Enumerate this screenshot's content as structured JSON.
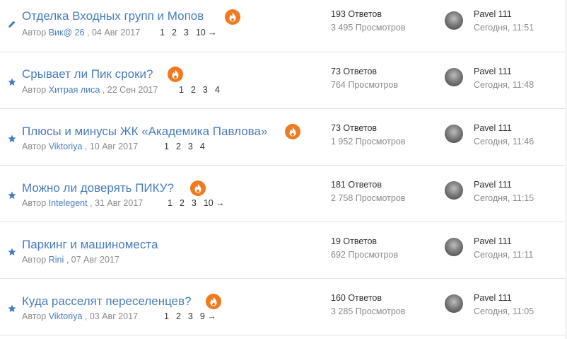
{
  "topics": [
    {
      "status_icon": "pencil-icon",
      "title": "Отделка Входных групп и Мопов",
      "hot": true,
      "author_prefix": "Автор",
      "author": "Вик@ 26",
      "date": ", 04 Авг 2017",
      "pages": [
        "1",
        "2",
        "3",
        "10 →"
      ],
      "replies": "193 Ответов",
      "views": "3 495 Просмотров",
      "last_user": "Pavel 111",
      "last_time": "Сегодня, 11:51"
    },
    {
      "status_icon": "star-icon",
      "title": "Срывает ли Пик сроки?",
      "hot": true,
      "author_prefix": "Автор",
      "author": "Хитрая лиса",
      "date": ", 22 Сен 2017",
      "pages": [
        "1",
        "2",
        "3",
        "4"
      ],
      "replies": "73 Ответов",
      "views": "764 Просмотров",
      "last_user": "Pavel 111",
      "last_time": "Сегодня, 11:48"
    },
    {
      "status_icon": "star-icon",
      "title": "Плюсы и минусы ЖК «Академика Павлова»",
      "hot": true,
      "author_prefix": "Автор",
      "author": "Viktoriya",
      "date": ", 10 Авг 2017",
      "pages": [
        "1",
        "2",
        "3",
        "4"
      ],
      "replies": "73 Ответов",
      "views": "1 952 Просмотров",
      "last_user": "Pavel 111",
      "last_time": "Сегодня, 11:46"
    },
    {
      "status_icon": "star-icon",
      "title": "Можно ли доверять ПИКУ?",
      "hot": true,
      "author_prefix": "Автор",
      "author": "Intelegent",
      "date": ", 31 Авг 2017",
      "pages": [
        "1",
        "2",
        "3",
        "10 →"
      ],
      "replies": "181 Ответов",
      "views": "2 758 Просмотров",
      "last_user": "Pavel 111",
      "last_time": "Сегодня, 11:15"
    },
    {
      "status_icon": "star-icon",
      "title": "Паркинг и машиноместа",
      "hot": false,
      "author_prefix": "Автор",
      "author": "Rini",
      "date": ", 07 Авг 2017",
      "pages": [],
      "replies": "19 Ответов",
      "views": "692 Просмотров",
      "last_user": "Pavel 111",
      "last_time": "Сегодня, 11:11"
    },
    {
      "status_icon": "star-icon",
      "title": "Куда расселят переселенцев?",
      "hot": true,
      "author_prefix": "Автор",
      "author": "Viktoriya",
      "date": ", 03 Авг 2017",
      "pages": [
        "1",
        "2",
        "3",
        "9 →"
      ],
      "replies": "160 Ответов",
      "views": "3 285 Просмотров",
      "last_user": "Pavel 111",
      "last_time": "Сегодня, 11:05"
    }
  ],
  "colors": {
    "link": "#4a7dbf",
    "hot_badge": "#f07a1f",
    "muted": "#8a8a8a",
    "divider": "#e3e3e3"
  }
}
